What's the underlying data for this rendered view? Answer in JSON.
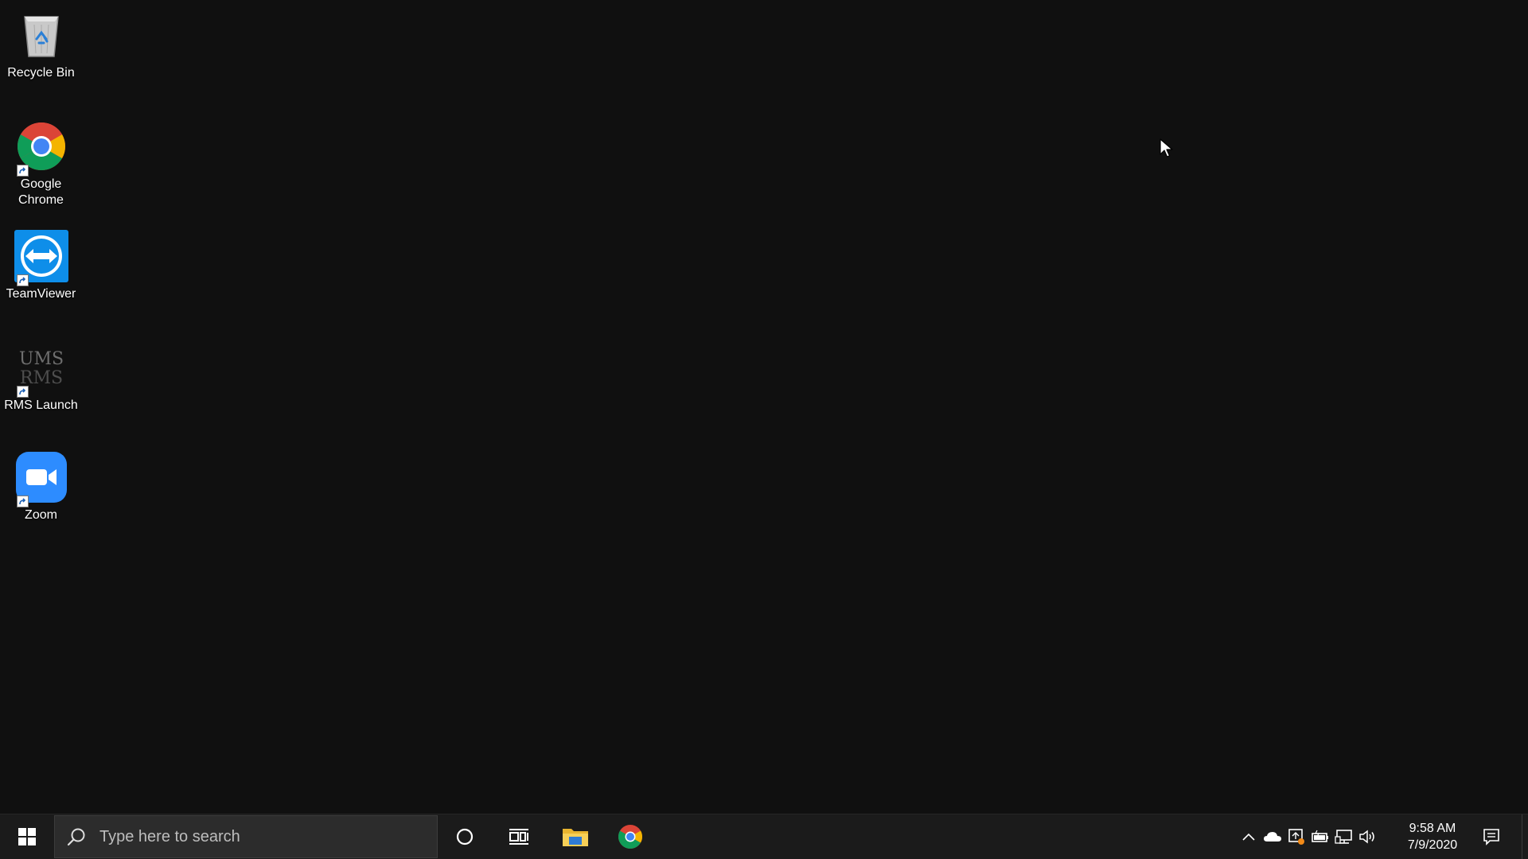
{
  "desktop": {
    "icons": [
      {
        "label": "Recycle Bin"
      },
      {
        "label": "Google Chrome"
      },
      {
        "label": "TeamViewer"
      },
      {
        "label": "RMS Launch"
      },
      {
        "label": "Zoom"
      }
    ],
    "rms_logo_text": "UMS RMS"
  },
  "taskbar": {
    "search_placeholder": "Type here to search",
    "clock": {
      "time": "9:58 AM",
      "date": "7/9/2020"
    }
  },
  "icons": {
    "start": "windows-logo-icon",
    "search": "search-icon",
    "cortana": "cortana-circle-icon",
    "task_view": "task-view-icon",
    "file_explorer": "folder-icon",
    "chrome": "chrome-icon",
    "tray": [
      "chevron-up-icon",
      "onedrive-cloud-icon",
      "security-icon",
      "battery-icon",
      "network-icon",
      "volume-icon"
    ],
    "notifications": "action-center-icon"
  },
  "colors": {
    "desktop_bg": "#101010",
    "taskbar_bg": "#1b1b1b",
    "search_bg": "#2c2c2c",
    "zoom_blue": "#2d8cff",
    "teamviewer_blue": "#0e8ee9"
  }
}
